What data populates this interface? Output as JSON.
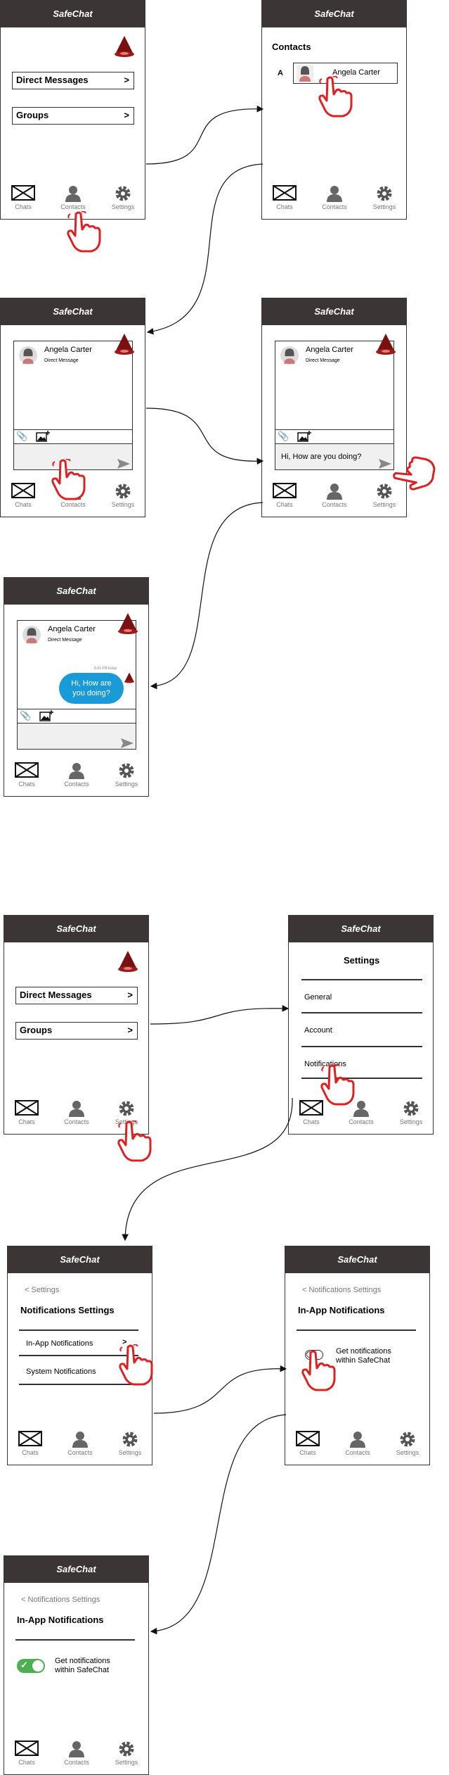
{
  "app": {
    "title": "SafeChat"
  },
  "nav": {
    "chats": "Chats",
    "contacts": "Contacts",
    "settings": "Settings"
  },
  "home": {
    "direct_messages": "Direct Messages",
    "groups": "Groups",
    "chevron": ">"
  },
  "contacts": {
    "title": "Contacts",
    "index_letter": "A",
    "contact_name": "Angela Carter"
  },
  "chat": {
    "contact_name": "Angela Carter",
    "subtitle": "Direct Message",
    "draft_message": "Hi, How are you doing?",
    "sent_message": "Hi, How are you doing?",
    "timestamp": "8:41 PM today"
  },
  "settings": {
    "title": "Settings",
    "general": "General",
    "account": "Account",
    "notifications": "Notifications"
  },
  "notif_settings": {
    "back": "< Settings",
    "title": "Notifications Settings",
    "in_app": "In-App Notifications",
    "system": "System Notifications",
    "chevron": ">"
  },
  "in_app": {
    "back": "< Notifications Settings",
    "title": "In-App Notifications",
    "toggle_label": "Get notifications within SafeChat",
    "toggle_label_line1": "Get notifications",
    "toggle_label_line2": "within SafeChat"
  },
  "colors": {
    "header": "#3b3535",
    "bubble": "#1a9ad6",
    "toggle_on": "#4caf50",
    "hand": "#e02020"
  }
}
